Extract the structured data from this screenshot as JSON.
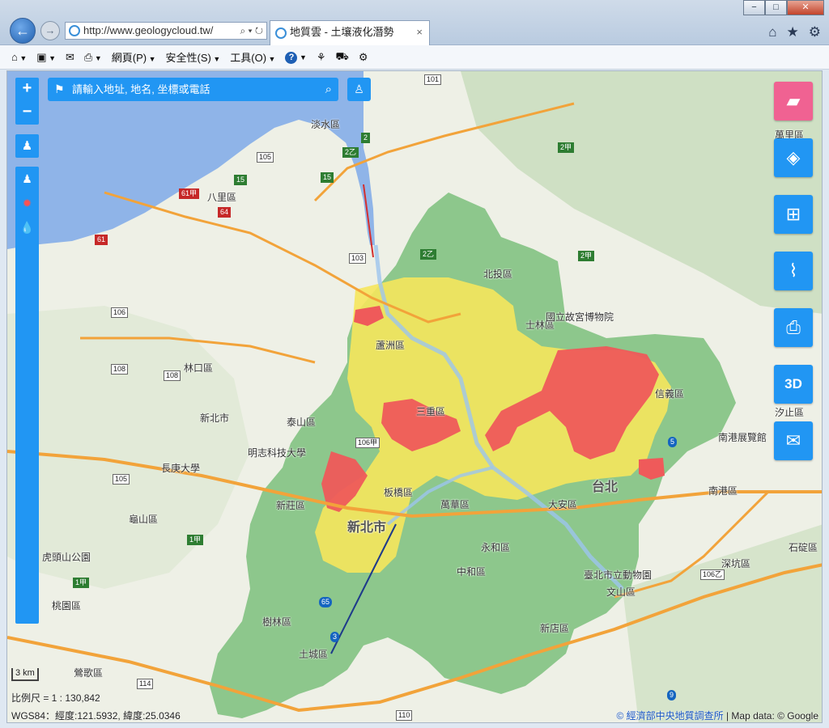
{
  "browser": {
    "address": "http://www.geologycloud.tw/",
    "tab_title": "地質雲 - 土壤液化潛勢",
    "tab_close": "×",
    "back": "←",
    "forward": "→",
    "window_min": "−",
    "window_max": "□",
    "window_close": "✕",
    "home_icon": "⌂",
    "fav_icon": "★",
    "tools_icon": "⚙",
    "addr_btns": "⌕ ▾ ↻",
    "command_bar": [
      "網頁(P)",
      "安全性(S)",
      "工具(O)"
    ],
    "help": "?"
  },
  "map": {
    "search_placeholder": "請輸入地址, 地名, 坐標或電話",
    "zoom_in": "+",
    "zoom_out": "−",
    "scale_bar": "3 km",
    "scale_text": "比例尺 = 1 : 130,842",
    "coords": "WGS84：經度:121.5932, 緯度:25.0346",
    "attribution_link": "© 經濟部中央地質調查所",
    "attribution_rest": " | Map data: © Google",
    "right_buttons": [
      "萬里區",
      "",
      "",
      "",
      "",
      "3D",
      ""
    ],
    "place_labels": [
      {
        "text": "淡水區"
      },
      {
        "text": "八里區"
      },
      {
        "text": "北投區"
      },
      {
        "text": "士林區"
      },
      {
        "text": "林口區"
      },
      {
        "text": "泰山區"
      },
      {
        "text": "新莊區"
      },
      {
        "text": "新北市"
      },
      {
        "text": "板橋區"
      },
      {
        "text": "萬華區"
      },
      {
        "text": "永和區"
      },
      {
        "text": "中和區"
      },
      {
        "text": "大安區"
      },
      {
        "text": "信義區"
      },
      {
        "text": "汐止區"
      },
      {
        "text": "南港區"
      },
      {
        "text": "文山區"
      },
      {
        "text": "新店區"
      },
      {
        "text": "樹林區"
      },
      {
        "text": "土城區"
      },
      {
        "text": "鶯歌區"
      },
      {
        "text": "龜山區"
      },
      {
        "text": "長庚大學"
      },
      {
        "text": "明志科技大學"
      },
      {
        "text": "國立故宮博物院"
      },
      {
        "text": "臺北市立動物園"
      },
      {
        "text": "南港展覽館"
      },
      {
        "text": "深坑區"
      },
      {
        "text": "石碇區"
      },
      {
        "text": "虎頭山公園"
      },
      {
        "text": "桃園區"
      },
      {
        "text": "台北"
      },
      {
        "text": "新北市"
      },
      {
        "text": "蘆洲區"
      },
      {
        "text": "三重區"
      }
    ],
    "route_shields": [
      "101",
      "2",
      "2乙",
      "105",
      "15",
      "15",
      "61甲",
      "64",
      "61",
      "103",
      "2乙",
      "2甲",
      "2甲",
      "106",
      "108",
      "108",
      "105",
      "106甲",
      "1甲",
      "1甲",
      "114",
      "110",
      "9",
      "106乙",
      "5",
      "3",
      "65"
    ]
  }
}
